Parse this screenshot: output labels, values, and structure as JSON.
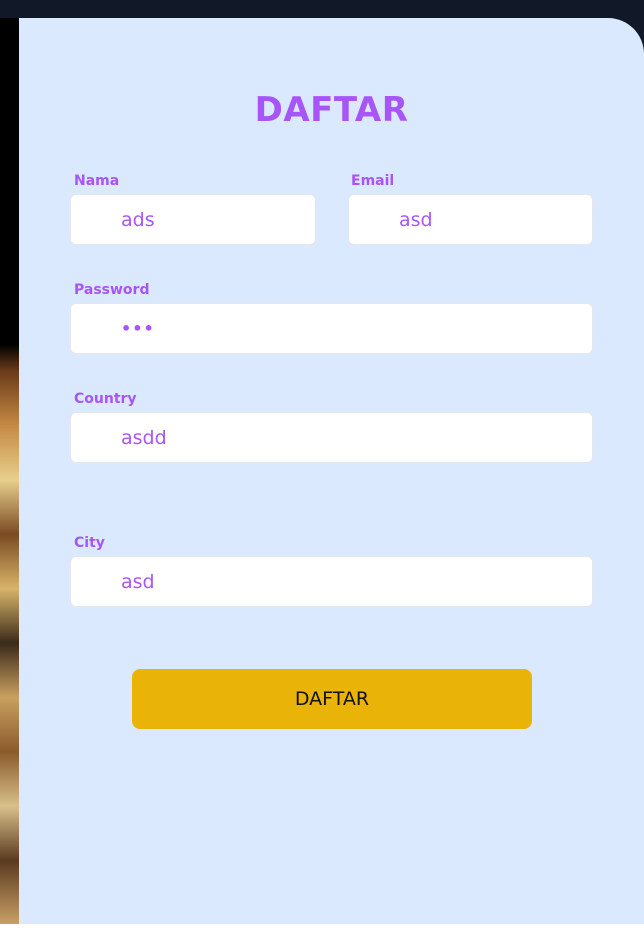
{
  "form": {
    "title": "DAFTAR",
    "fields": {
      "nama": {
        "label": "Nama",
        "value": "ads"
      },
      "email": {
        "label": "Email",
        "value": "asd"
      },
      "password": {
        "label": "Password",
        "value": "•••"
      },
      "country": {
        "label": "Country",
        "value": "asdd"
      },
      "city": {
        "label": "City",
        "value": "asd"
      }
    },
    "submit_label": "DAFTAR"
  },
  "colors": {
    "accent": "#a855f7",
    "card_background": "#dbe9fe",
    "button": "#eab308",
    "header_bar": "#111827"
  }
}
